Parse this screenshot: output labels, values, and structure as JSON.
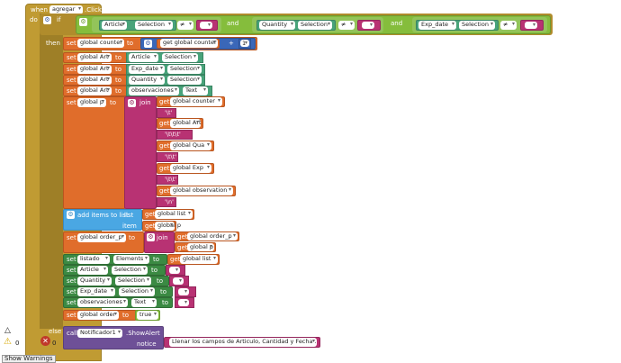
{
  "event": {
    "when": "when",
    "component": "agregar",
    "event": ".Click",
    "do": "do"
  },
  "if_block": {
    "if": "if",
    "then": "then"
  },
  "condition": {
    "article": "Article",
    "selection": "Selection",
    "op": "≠",
    "and1": "and",
    "quantity": "Quantity",
    "and2": "and",
    "exp_date": "Exp_date"
  },
  "kw": {
    "set": "set",
    "to": "to",
    "get": "get",
    "join": "join",
    "call": "call",
    "item": "item",
    "list": "list",
    "notice": "notice"
  },
  "counter": {
    "var": "global counter",
    "get": "get global counter",
    "plus": "+",
    "num": "1"
  },
  "sets": [
    {
      "var": "global Art",
      "comp": "Article",
      "prop": "Selection"
    },
    {
      "var": "global Art",
      "comp": "Exp_date",
      "prop": "Selection"
    },
    {
      "var": "global Art",
      "comp": "Quantity",
      "prop": "Selection"
    },
    {
      "var": "global Art",
      "comp": "observaciones",
      "prop": "Text"
    }
  ],
  "join_block": {
    "target": "global p",
    "items": [
      "global counter",
      "'\\t'",
      "global Art",
      "'\\t\\t\\t'",
      "global Qua",
      "'\\t\\t'",
      "global Exp",
      "'\\t\\t'",
      "global observation",
      "'\\n'"
    ]
  },
  "add_items": {
    "label": "add items to list",
    "list_label": "list",
    "list_var": "global list",
    "item_var": "global p"
  },
  "order_p": {
    "var": "global order_p",
    "join_a": "global order_p",
    "join_b": "global p"
  },
  "listado": {
    "comp": "listado",
    "prop": "Elements",
    "get": "global list"
  },
  "resets": [
    {
      "comp": "Article",
      "prop": "Selection"
    },
    {
      "comp": "Quantity",
      "prop": "Selection"
    },
    {
      "comp": "Exp_date",
      "prop": "Selection"
    },
    {
      "comp": "observaciones",
      "prop": "Text"
    }
  ],
  "order": {
    "var": "global order",
    "value": "true"
  },
  "else": {
    "label": "else"
  },
  "notifier": {
    "component": "Notificador1",
    "method": ".ShowAlert",
    "notice": "Llenar los campos de Articulo, Cantidad y Fecha ..."
  },
  "status": {
    "warnings": "0",
    "errors": "0",
    "show_warnings": "Show Warnings"
  }
}
